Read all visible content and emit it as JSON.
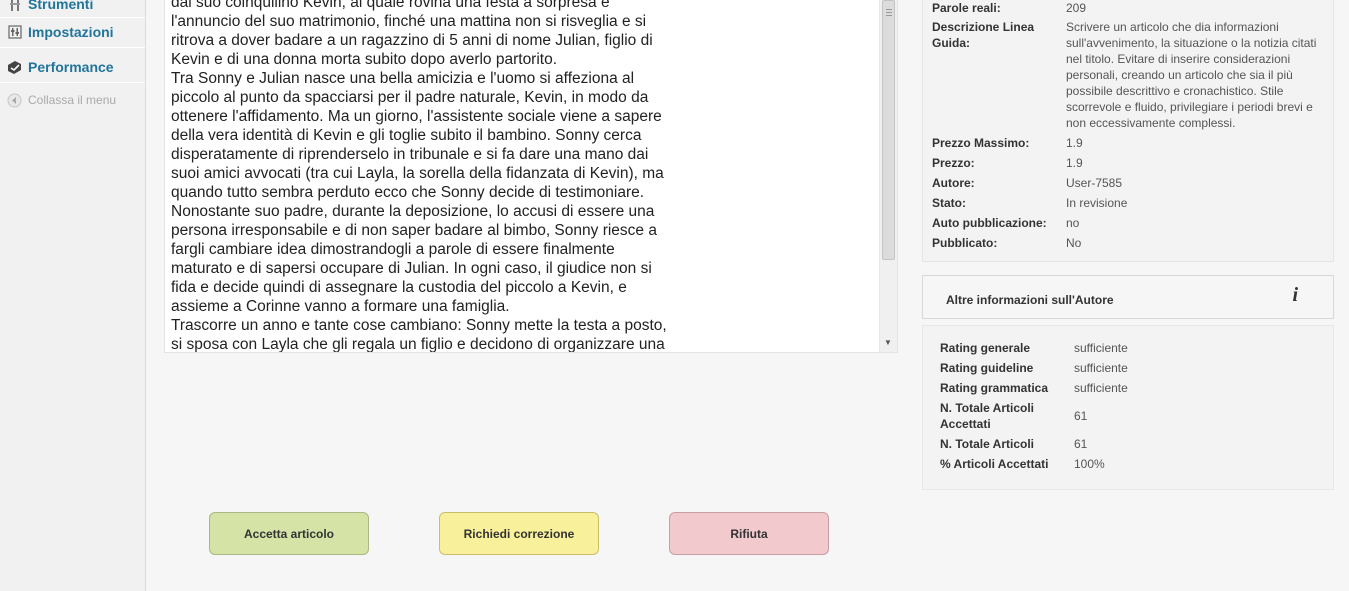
{
  "sidebar": {
    "items": [
      {
        "label": "Strumenti",
        "icon": "tools-icon"
      },
      {
        "label": "Impostazioni",
        "icon": "settings-icon"
      },
      {
        "label": "Performance",
        "icon": "performance-icon"
      }
    ],
    "collapse_label": "Collassa il menu"
  },
  "article": {
    "text": "dal suo coinquilino Kevin, al quale rovina una festa a sorpresa e\nl'annuncio del suo matrimonio, finché una mattina non si risveglia e si\nritrova a dover badare a un ragazzino di 5 anni di nome Julian, figlio di\nKevin e di una donna morta subito dopo averlo partorito.\nTra Sonny e Julian nasce una bella amicizia e l'uomo si affeziona al\npiccolo al punto da spacciarsi per il padre naturale, Kevin, in modo da\nottenere l'affidamento. Ma un giorno, l'assistente sociale viene a sapere\ndella vera identità di Kevin e gli toglie subito il bambino. Sonny cerca\ndisperatamente di riprenderselo in tribunale e si fa dare una mano dai\nsuoi amici avvocati (tra cui Layla, la sorella della fidanzata di Kevin), ma\nquando tutto sembra perduto ecco che Sonny decide di testimoniare.\nNonostante suo padre, durante la deposizione, lo accusi di essere una\npersona irresponsabile e di non saper badare al bimbo, Sonny riesce a\nfargli cambiare idea dimostrandogli a parole di essere finalmente\nmaturato e di sapersi occupare di Julian. In ogni caso, il giudice non si\nfida e decide quindi di assegnare la custodia del piccolo a Kevin, e\nassieme a Corinne vanno a formare una famiglia.\nTrascorre un anno e tante cose cambiano: Sonny mette la testa a posto,\nsi sposa con Layla che gli regala un figlio e decidono di organizzare una"
  },
  "info": {
    "parole_label": "Parole reali:",
    "parole_value": "209",
    "descr_label": "Descrizione Linea Guida:",
    "descr_value": "Scrivere un articolo che dia informazioni sull'avvenimento, la situazione o la notizia citati nel titolo. Evitare di inserire considerazioni personali, creando un articolo che sia il più possibile descrittivo e cronachistico. Stile scorrevole e fluido, privilegiare i periodi brevi e non eccessivamente complessi.",
    "rows": [
      {
        "k": "Prezzo Massimo:",
        "v": "1.9"
      },
      {
        "k": "Prezzo:",
        "v": "1.9"
      },
      {
        "k": "Autore:",
        "v": "User-7585"
      },
      {
        "k": "Stato:",
        "v": "In revisione"
      },
      {
        "k": "Auto pubblicazione:",
        "v": "no"
      },
      {
        "k": "Pubblicato:",
        "v": "No"
      }
    ]
  },
  "author": {
    "title": "Altre informazioni sull'Autore",
    "rows": [
      {
        "k": "Rating generale",
        "v": "sufficiente"
      },
      {
        "k": "Rating guideline",
        "v": "sufficiente"
      },
      {
        "k": "Rating grammatica",
        "v": "sufficiente"
      },
      {
        "k": "N. Totale Articoli Accettati",
        "v": "61"
      },
      {
        "k": "N. Totale Articoli",
        "v": "61"
      },
      {
        "k": "% Articoli Accettati",
        "v": "100%"
      }
    ]
  },
  "buttons": {
    "accept": "Accetta articolo",
    "correct": "Richiedi correzione",
    "reject": "Rifiuta"
  }
}
